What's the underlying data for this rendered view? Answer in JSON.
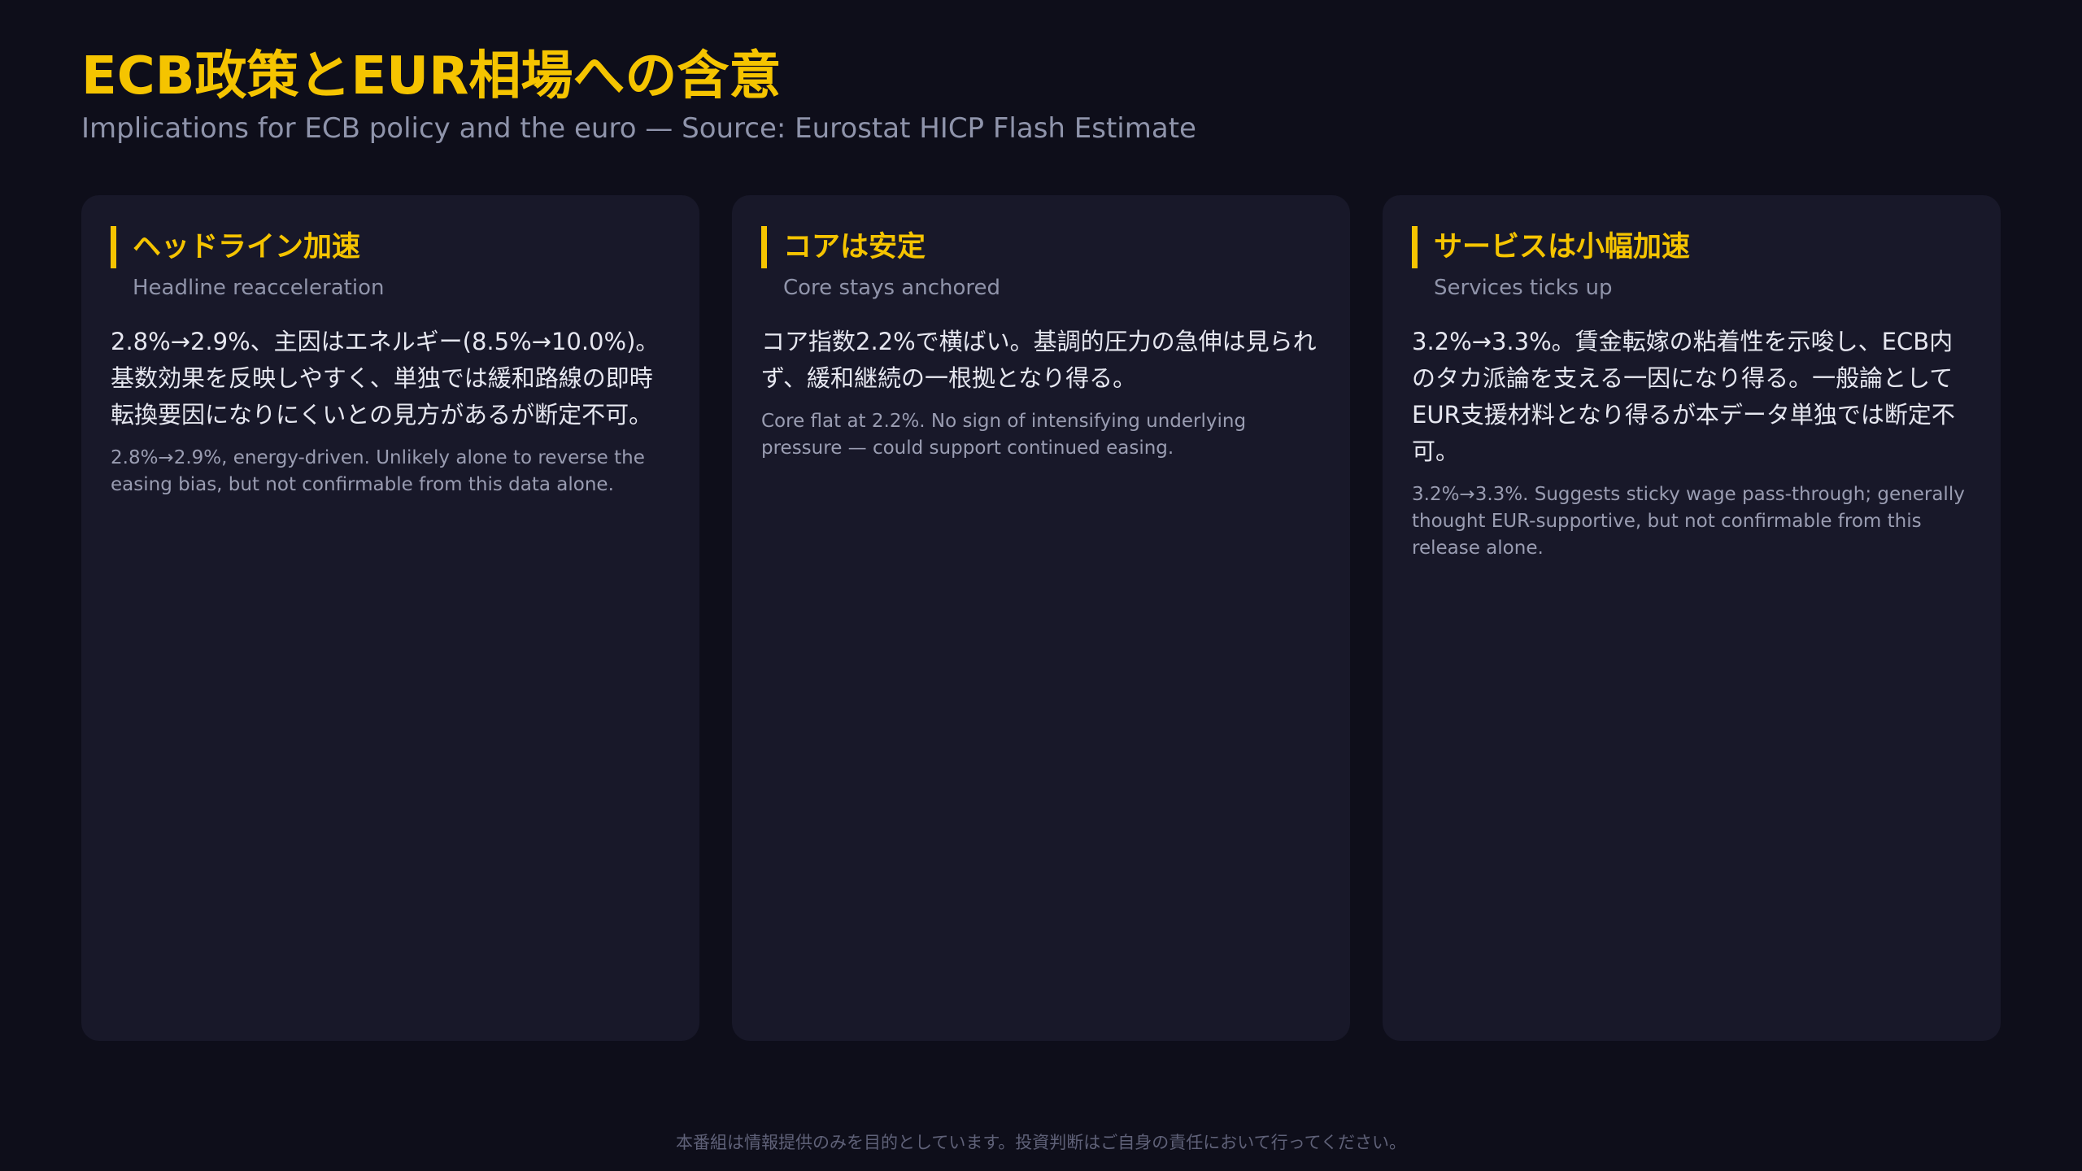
{
  "header": {
    "title": "ECB政策とEUR相場への含意",
    "subtitle": "Implications for ECB policy and the euro — Source: Eurostat HICP Flash Estimate"
  },
  "cards": [
    {
      "title": "ヘッドライン加速",
      "subtitle": "Headline reacceleration",
      "body_jp": "2.8%→2.9%、主因はエネルギー(8.5%→10.0%)。基数効果を反映しやすく、単独では緩和路線の即時転換要因になりにくいとの見方があるが断定不可。",
      "body_en": "2.8%→2.9%, energy-driven. Unlikely alone to reverse the easing bias, but not confirmable from this data alone."
    },
    {
      "title": "コアは安定",
      "subtitle": "Core stays anchored",
      "body_jp": "コア指数2.2%で横ばい。基調的圧力の急伸は見られず、緩和継続の一根拠となり得る。",
      "body_en": "Core flat at 2.2%. No sign of intensifying underlying pressure — could support continued easing."
    },
    {
      "title": "サービスは小幅加速",
      "subtitle": "Services ticks up",
      "body_jp": "3.2%→3.3%。賃金転嫁の粘着性を示唆し、ECB内のタカ派論を支える一因になり得る。一般論としてEUR支援材料となり得るが本データ単独では断定不可。",
      "body_en": "3.2%→3.3%. Suggests sticky wage pass-through; generally thought EUR-supportive, but not confirmable from this release alone."
    }
  ],
  "footer": {
    "disclaimer": "本番組は情報提供のみを目的としています。投資判断はご自身の責任において行ってください。"
  },
  "colors": {
    "background": "#0e0e1a",
    "card_background": "#181829",
    "accent": "#f5c400",
    "text_primary": "#e6e7f0",
    "text_secondary": "#9a9db2"
  }
}
